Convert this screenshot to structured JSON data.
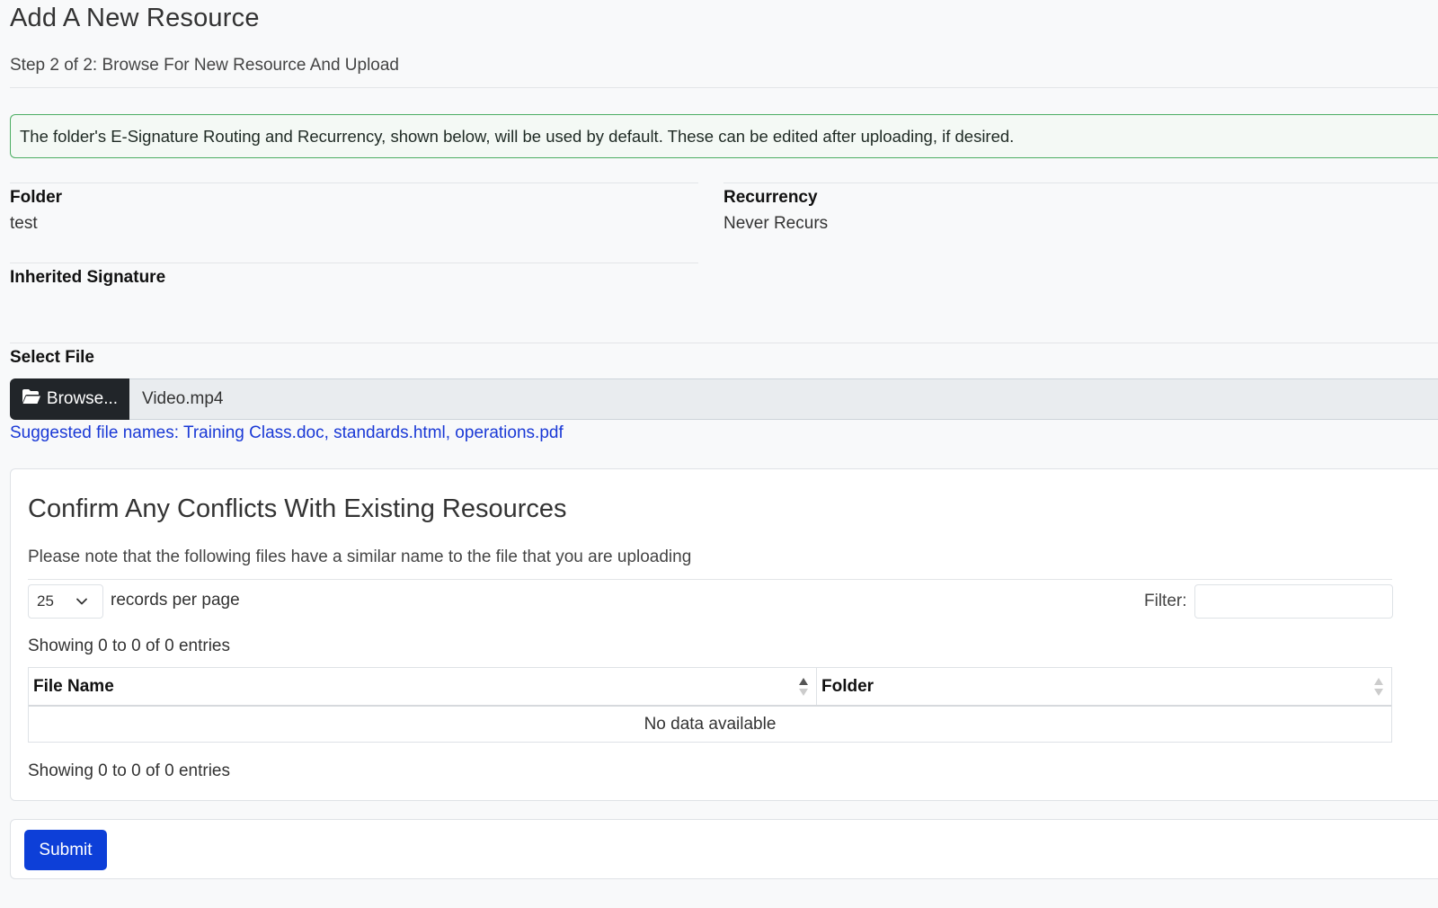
{
  "header": {
    "title": "Add A New Resource",
    "subtitle": "Step 2 of 2: Browse For New Resource And Upload"
  },
  "alert": {
    "text": "The folder's E-Signature Routing and Recurrency, shown below, will be used by default. These can be edited after uploading, if desired."
  },
  "details": {
    "folder_label": "Folder",
    "folder_value": "test",
    "recurrency_label": "Recurrency",
    "recurrency_value": "Never Recurs",
    "inherited_signature_label": "Inherited Signature",
    "inherited_signature_value": ""
  },
  "file_select": {
    "label": "Select File",
    "browse_label": "Browse...",
    "browse_icon": "folder-open-icon",
    "selected_file": "Video.mp4",
    "suggested": "Suggested file names: Training Class.doc, standards.html, operations.pdf"
  },
  "conflicts": {
    "title": "Confirm Any Conflicts With Existing Resources",
    "note": "Please note that the following files have a similar name to the file that you are uploading",
    "page_length": "25",
    "records_per_page": "records per page",
    "filter_label": "Filter:",
    "filter_value": "",
    "showing_top": "Showing 0 to 0 of 0 entries",
    "showing_bottom": "Showing 0 to 0 of 0 entries",
    "columns": [
      "File Name",
      "Folder"
    ],
    "empty_text": "No data available"
  },
  "submit": {
    "label": "Submit"
  },
  "colors": {
    "alert_border": "#4cae63",
    "browse_bg": "#212529",
    "link": "#1a39d6",
    "submit_bg": "#0d3fd8"
  }
}
